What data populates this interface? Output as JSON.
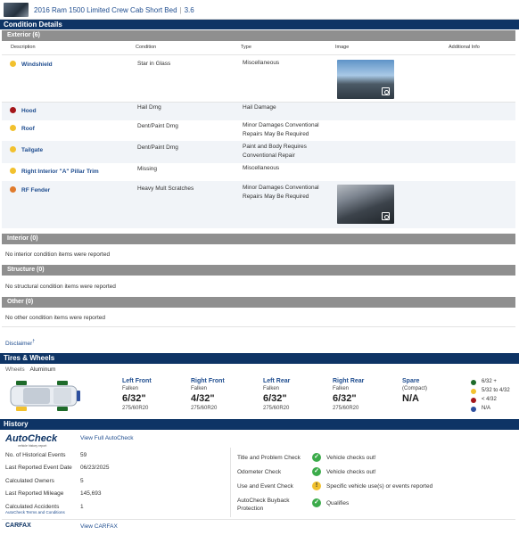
{
  "header": {
    "vehicle": "2016 Ram 1500 Limited Crew Cab Short Bed",
    "engine": "3.6"
  },
  "condition": {
    "section_title": "Condition Details",
    "exterior_title": "Exterior (6)",
    "columns": [
      "Description",
      "Condition",
      "Type",
      "Image",
      "Additional Info"
    ],
    "items": [
      {
        "name": "Windshield",
        "condition": "Star in Glass",
        "type": "Miscellaneous",
        "severity_color": "#f2c12e"
      },
      {
        "name": "Hood",
        "condition": "Hail Dmg",
        "type": "Hail Damage",
        "severity_color": "#a4161a"
      },
      {
        "name": "Roof",
        "condition": "Dent/Paint Dmg",
        "type": "Minor Damages Conventional Repairs May Be Required",
        "severity_color": "#f2c12e"
      },
      {
        "name": "Tailgate",
        "condition": "Dent/Paint Dmg",
        "type": "Paint and Body Requires Conventional Repair",
        "severity_color": "#f2c12e"
      },
      {
        "name": "Right Interior \"A\" Pillar Trim",
        "condition": "Missing",
        "type": "Miscellaneous",
        "severity_color": "#f2c12e"
      },
      {
        "name": "RF Fender",
        "condition": "Heavy Mult Scratches",
        "type": "Minor Damages Conventional Repairs May Be Required",
        "severity_color": "#e07b2c"
      }
    ],
    "interior_title": "Interior (0)",
    "interior_empty": "No interior condition items were reported",
    "structure_title": "Structure (0)",
    "structure_empty": "No structural condition items were reported",
    "other_title": "Other (0)",
    "other_empty": "No other condition items were reported",
    "disclaimer": "Disclaimer",
    "disclaimer_mark": "†"
  },
  "tires": {
    "section_title": "Tires & Wheels",
    "wheels_label": "Wheels",
    "wheels_value": "Aluminum",
    "positions": [
      {
        "pos": "Left Front",
        "brand": "Falken",
        "tread": "6/32\"",
        "size": "275/60R20"
      },
      {
        "pos": "Right Front",
        "brand": "Falken",
        "tread": "4/32\"",
        "size": "275/60R20"
      },
      {
        "pos": "Left Rear",
        "brand": "Falken",
        "tread": "6/32\"",
        "size": "275/60R20"
      },
      {
        "pos": "Right Rear",
        "brand": "Falken",
        "tread": "6/32\"",
        "size": "275/60R20"
      }
    ],
    "spare": {
      "pos": "Spare",
      "type": "(Compact)",
      "tread": "N/A"
    },
    "legend": [
      {
        "label": "6/32 +",
        "color": "#1e6b2a"
      },
      {
        "label": "5/32 to 4/32",
        "color": "#f2c12e"
      },
      {
        "label": "< 4/32",
        "color": "#a4161a"
      },
      {
        "label": "N/A",
        "color": "#2d4f9e"
      }
    ]
  },
  "history": {
    "section_title": "History",
    "autocheck_logo": "AutoCheck",
    "autocheck_tagline": "vehicle history report",
    "view_full": "View Full AutoCheck",
    "rows": [
      {
        "label": "No. of Historical Events",
        "value": "59"
      },
      {
        "label": "Last Reported Event Date",
        "value": "06/23/2025"
      },
      {
        "label": "Calculated Owners",
        "value": "5"
      },
      {
        "label": "Last Reported Mileage",
        "value": "145,693"
      },
      {
        "label": "Calculated Accidents",
        "value": "1"
      }
    ],
    "terms_link": "AutoCheck Terms and Conditions",
    "checks": [
      {
        "label": "Title and Problem Check",
        "status": "Vehicle checks out!",
        "color": "#3bab4a",
        "glyph": "✓"
      },
      {
        "label": "Odometer Check",
        "status": "Vehicle checks out!",
        "color": "#3bab4a",
        "glyph": "✓"
      },
      {
        "label": "Use and Event Check",
        "status": "Specific vehicle use(s) or events reported",
        "color": "#f2c12e",
        "glyph": "!"
      },
      {
        "label": "AutoCheck Buyback Protection",
        "status": "Qualifies",
        "color": "#3bab4a",
        "glyph": "✓"
      }
    ],
    "carfax_label": "CARFAX",
    "view_carfax": "View CARFAX"
  }
}
